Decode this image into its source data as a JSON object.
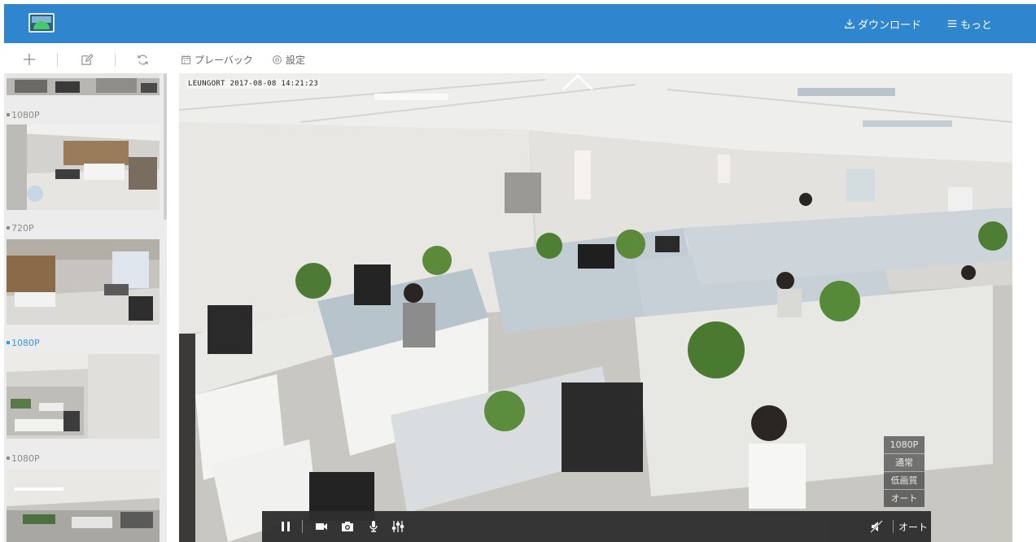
{
  "header": {
    "download_label": "ダウンロード",
    "more_label": "もっと"
  },
  "toolbar": {
    "playback_label": "プレーバック",
    "settings_label": "設定"
  },
  "sidebar": {
    "cameras": [
      {
        "label": "1080P",
        "active": false
      },
      {
        "label": "720P",
        "active": false
      },
      {
        "label": "1080P",
        "active": true
      },
      {
        "label": "1080P",
        "active": false
      }
    ]
  },
  "video": {
    "osd_timestamp": "LEUNGORT 2017-08-08 14:21:23",
    "quality_options": [
      "1080P",
      "通常",
      "低画質",
      "オート"
    ],
    "mode_label": "オート"
  },
  "colors": {
    "header_bg": "#2f86cf",
    "active_label": "#3a94dc",
    "control_bar_bg": "#2f2f2f"
  },
  "icons": {
    "logo": "app-logo",
    "download": "download-icon",
    "more": "hamburger-menu-icon",
    "add": "plus-icon",
    "edit": "edit-icon",
    "refresh": "refresh-icon",
    "playback": "calendar-icon",
    "settings": "gear-icon",
    "pause": "pause-icon",
    "record": "video-camera-icon",
    "snapshot": "camera-icon",
    "talk": "microphone-icon",
    "adjust": "sliders-icon",
    "mute": "speaker-muted-icon"
  }
}
